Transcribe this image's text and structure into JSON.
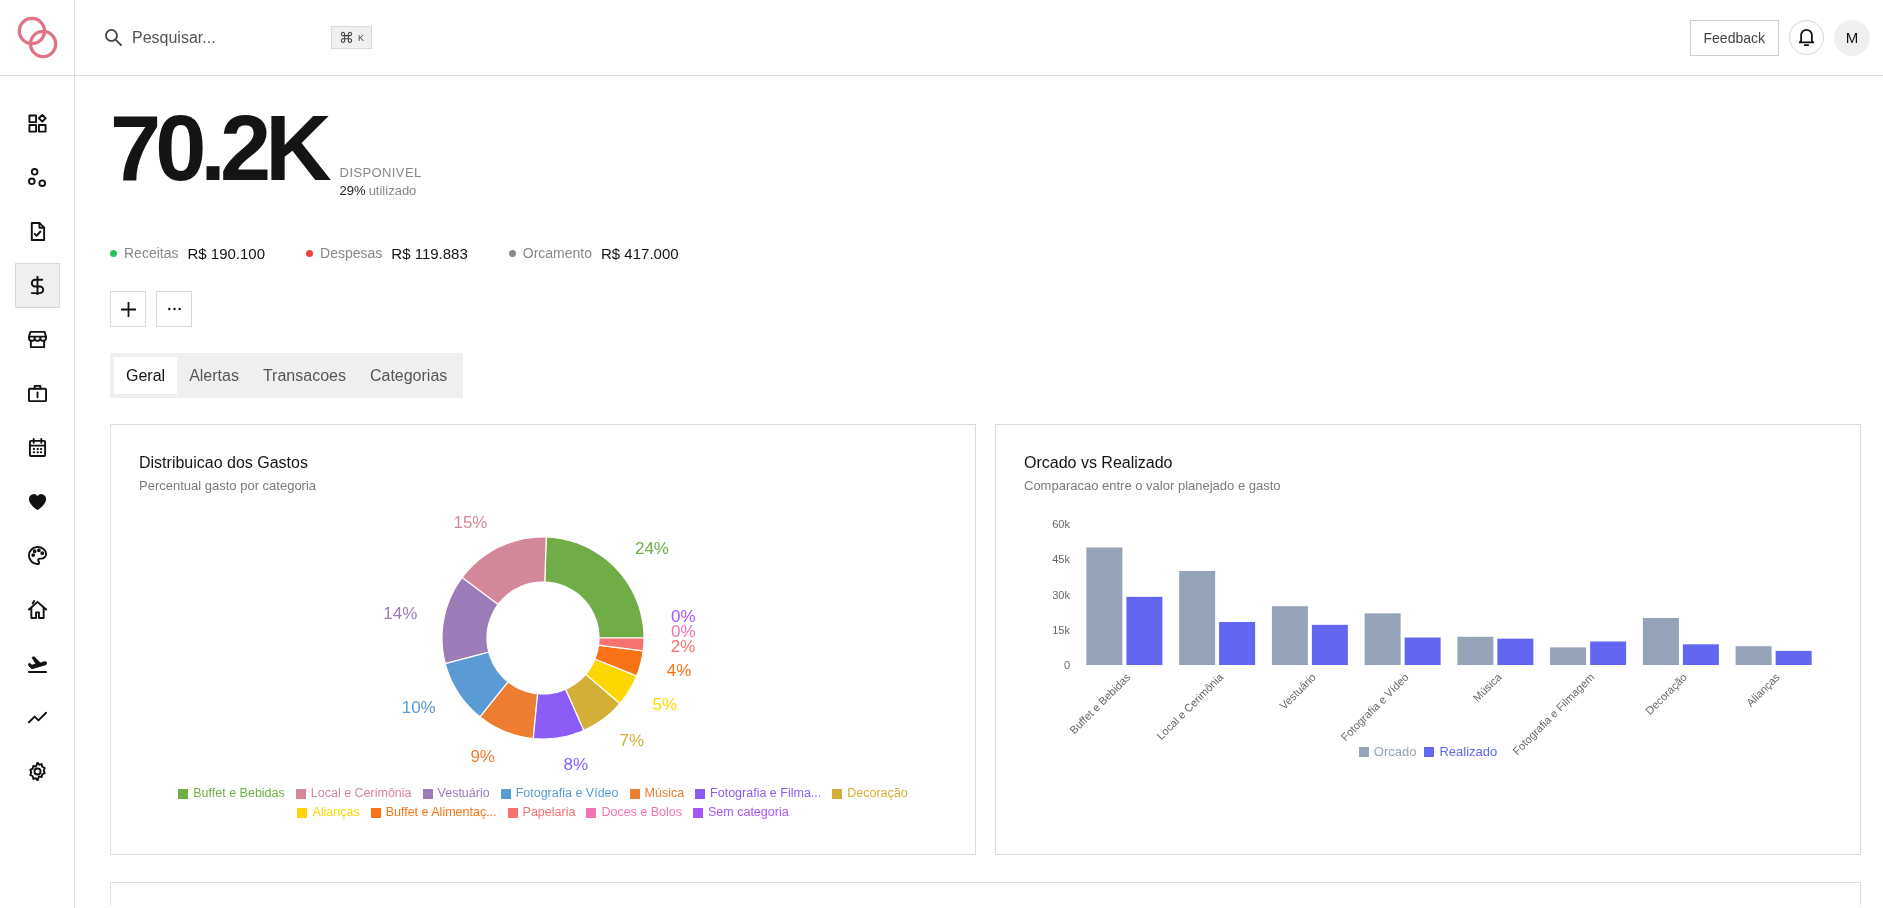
{
  "header": {
    "search": {
      "placeholder": "Pesquisar..."
    },
    "shortcut": "⌘$^{K}$",
    "feedback": "Feedback",
    "avatar": "M"
  },
  "sidebar": {
    "items": [
      {
        "selected": false
      },
      {
        "selected": false
      },
      {
        "selected": false
      },
      {
        "selected": true
      },
      {
        "selected": false
      },
      {
        "selected": false
      },
      {
        "selected": false
      },
      {
        "selected": false
      },
      {
        "selected": false
      },
      {
        "selected": false
      },
      {
        "selected": false
      },
      {
        "selected": false
      },
      {
        "selected": false
      }
    ]
  },
  "summary": {
    "amount": "70.2K",
    "amount_label": "DISPONIVEL",
    "used_percent": "29%",
    "used_label": "utilizado",
    "stats": [
      {
        "label": "Receitas",
        "value": "R$ 190.100",
        "color": "#22c55e"
      },
      {
        "label": "Despesas",
        "value": "R$ 119.883",
        "color": "#ef4444"
      },
      {
        "label": "Orcamento",
        "value": "R$ 417.000",
        "color": "#888888"
      }
    ]
  },
  "tabs": [
    {
      "label": "Geral",
      "selected": true
    },
    {
      "label": "Alertas",
      "selected": false
    },
    {
      "label": "Transacoes",
      "selected": false
    },
    {
      "label": "Categorias",
      "selected": false
    }
  ],
  "cards": [
    {
      "title": "Distribuicao dos Gastos",
      "subtitle": "Percentual gasto por categoria",
      "chart_data": {
        "type": "donut",
        "categories": [
          "Buffet e Bebidas",
          "Local e Cerimônia",
          "Vestuário",
          "Fotografia e Vídeo",
          "Música",
          "Fotografia e Filma...",
          "Decoração",
          "Alianças",
          "Buffet e Alimentaç...",
          "Papelaria",
          "Doces e Bolos",
          "Sem categoria"
        ],
        "values": [
          24,
          15,
          14,
          10,
          9,
          8,
          7,
          5,
          4,
          2,
          0,
          0
        ],
        "colors": [
          "#70ad47",
          "#d5879a",
          "#9b7cb8",
          "#5b9bd5",
          "#ed7d31",
          "#8b5cf6",
          "#d4af37",
          "#ffd700",
          "#f97316",
          "#f87171",
          "#f472b6",
          "#a855f7"
        ],
        "value_labels": [
          "24%",
          "15%",
          "14%",
          "10%",
          "9%",
          "8%",
          "7%",
          "5%",
          "4%",
          "2%",
          "0%",
          "0%"
        ],
        "legend": "bottom"
      }
    },
    {
      "title": "Orcado vs Realizado",
      "subtitle": "Comparacao entre o valor planejado e gasto",
      "chart_data": {
        "type": "bar",
        "categories": [
          "Buffet e Bebidas",
          "Local e Cerimônia",
          "Vestuário",
          "Fotografia e Vídeo",
          "Música",
          "Fotografia e Filmagem",
          "Decoração",
          "Alianças"
        ],
        "series": [
          {
            "name": "Orcado",
            "color": "#94a3b8",
            "values": [
              50000,
              40000,
              25000,
              22000,
              12000,
              7500,
              20000,
              8000
            ]
          },
          {
            "name": "Realizado",
            "color": "#6366f1",
            "values": [
              29000,
              18300,
              17100,
              11700,
              11200,
              10000,
              8800,
              6000
            ]
          }
        ],
        "ylim": [
          0,
          60000
        ],
        "yticks": [
          {
            "value": 0,
            "label": "0"
          },
          {
            "value": 15000,
            "label": "15k"
          },
          {
            "value": 30000,
            "label": "30k"
          },
          {
            "value": 45000,
            "label": "45k"
          },
          {
            "value": 60000,
            "label": "60k"
          }
        ],
        "legend": "bottom"
      }
    }
  ]
}
